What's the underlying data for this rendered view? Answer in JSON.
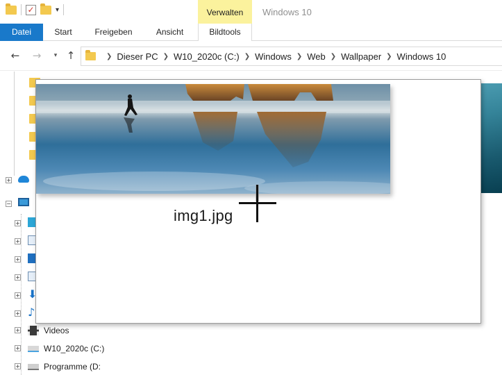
{
  "window": {
    "title": "Windows 10"
  },
  "ribbon": {
    "context_group": "Verwalten",
    "tabs": [
      {
        "label": "Datei"
      },
      {
        "label": "Start"
      },
      {
        "label": "Freigeben"
      },
      {
        "label": "Ansicht"
      },
      {
        "label": "Bildtools"
      }
    ]
  },
  "address": {
    "breadcrumbs": [
      "Dieser PC",
      "W10_2020c (C:)",
      "Windows",
      "Web",
      "Wallpaper",
      "Windows 10"
    ]
  },
  "navigation": {
    "items": [
      {
        "label": "Videos",
        "icon": "video-icon"
      },
      {
        "label": "W10_2020c (C:)",
        "icon": "drive-icon"
      },
      {
        "label": "Programme (D:",
        "icon": "drive-icon"
      }
    ]
  },
  "drag": {
    "filename": "img1.jpg"
  },
  "colors": {
    "accent": "#1979ca",
    "context_group": "#fbf29d",
    "folder": "#f3c94f"
  }
}
